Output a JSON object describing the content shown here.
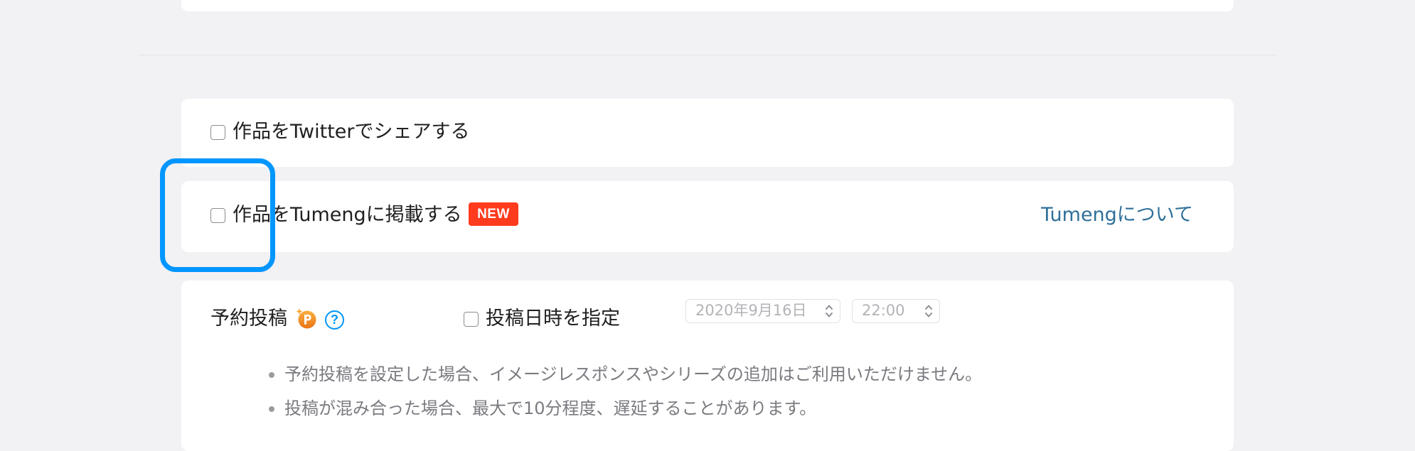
{
  "twitter_share": {
    "label": "作品をTwitterでシェアする",
    "checked": false
  },
  "tumeng": {
    "label": "作品をTumengに掲載する",
    "badge": "NEW",
    "about_link": "Tumengについて",
    "checked": false
  },
  "schedule": {
    "title": "予約投稿",
    "premium_icon": "premium-p-icon",
    "help_icon_glyph": "?",
    "specify_label": "投稿日時を指定",
    "specify_checked": false,
    "date_value": "2020年9月16日",
    "time_value": "22:00",
    "notes": [
      "予約投稿を設定した場合、イメージレスポンスやシリーズの追加はご利用いただけません。",
      "投稿が混み合った場合、最大で10分程度、遅延することがあります。"
    ]
  },
  "colors": {
    "page_background": "#f2f1f4",
    "card_background": "#ffffff",
    "badge_new": "#ff3b1e",
    "link": "#2f6f9a",
    "help_icon": "#0096fa",
    "highlight_ring": "#0096ff",
    "premium_icon": "#f08a24"
  }
}
